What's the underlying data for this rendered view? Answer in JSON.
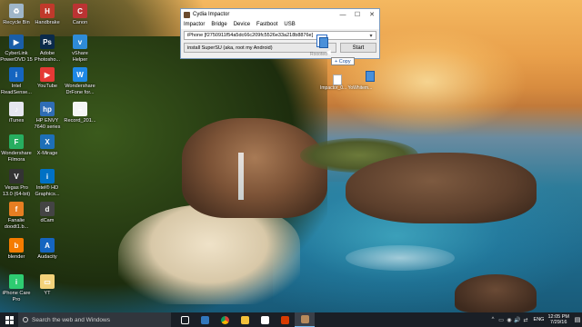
{
  "desktop_icons": [
    {
      "label": "Recycle Bin",
      "color": "#9fb6c9",
      "char": "♻"
    },
    {
      "label": "Handbrake",
      "color": "#c0392b",
      "char": "H"
    },
    {
      "label": "Canon",
      "color": "#b33",
      "char": "C"
    },
    {
      "label": "CyberLink\nPowerDVD 15",
      "color": "#1a5ea8",
      "char": "▶"
    },
    {
      "label": "Adobe\nPhotosho...",
      "color": "#0b2a4a",
      "char": "Ps"
    },
    {
      "label": "vShare\nHelper",
      "color": "#2e8bd8",
      "char": "v"
    },
    {
      "label": "Intel\nReadSense...",
      "color": "#1565c0",
      "char": "i"
    },
    {
      "label": "YouTube",
      "color": "#e53935",
      "char": "▶"
    },
    {
      "label": "Wondershare\nDrFone for...",
      "color": "#1e88e5",
      "char": "W"
    },
    {
      "label": "iTunes",
      "color": "#e6e6f0",
      "char": "♪"
    },
    {
      "label": "HP ENVY\n7640 series",
      "color": "#2f6db5",
      "char": "hp"
    },
    {
      "label": "Record_201...",
      "color": "#f5f5f5",
      "char": "≡"
    },
    {
      "label": "Wondershare\nFilmora",
      "color": "#27ae60",
      "char": "F"
    },
    {
      "label": "X-Mirage",
      "color": "#1d6fb8",
      "char": "X"
    },
    {
      "label": "Vegas Pro\n13.0 (64-bit)",
      "color": "#333",
      "char": "V"
    },
    {
      "label": "Intel® HD\nGraphics...",
      "color": "#0071c5",
      "char": "i"
    },
    {
      "label": "Fanalie\ndoodt1.b...",
      "color": "#e67e22",
      "char": "f"
    },
    {
      "label": "dCam",
      "color": "#444",
      "char": "d"
    },
    {
      "label": "blender",
      "color": "#f57c00",
      "char": "b"
    },
    {
      "label": "Audacity",
      "color": "#1565c0",
      "char": "A"
    },
    {
      "label": "iPhone Care\nPro",
      "color": "#2ecc71",
      "char": "i"
    },
    {
      "label": "YT",
      "color": "#f3d27a",
      "char": "▭"
    }
  ],
  "window": {
    "title": "Cydia Impactor",
    "menu": [
      "Impactor",
      "Bridge",
      "Device",
      "Fastboot",
      "USB"
    ],
    "device": "iPhone [f2750911f54a5dc66c209fc5526e33a218b8876e]",
    "action": "install SuperSU (aka, root my Android)",
    "start_label": "Start",
    "minimize": "—",
    "maximize": "☐",
    "close": "✕"
  },
  "drag": {
    "copy_tip": "+ Copy",
    "ghost_label": "Roooted",
    "files_label": "Impactor_0...   YoWhitem..."
  },
  "taskbar": {
    "search_placeholder": "Search the web and Windows",
    "apps": [
      {
        "name": "task-view",
        "color": "#ffffff"
      },
      {
        "name": "edge",
        "color": "#3277bc"
      },
      {
        "name": "chrome",
        "color": "#e8b11c"
      },
      {
        "name": "explorer",
        "color": "#f3c03a"
      },
      {
        "name": "store",
        "color": "#ffffff"
      },
      {
        "name": "office",
        "color": "#d83b01"
      },
      {
        "name": "impactor",
        "color": "#b78a5c"
      }
    ],
    "tray_icons": [
      "^",
      "▭",
      "◉",
      "🔊",
      "⇄"
    ],
    "language": "ENG",
    "time": "12:05 PM",
    "date": "7/29/16"
  }
}
